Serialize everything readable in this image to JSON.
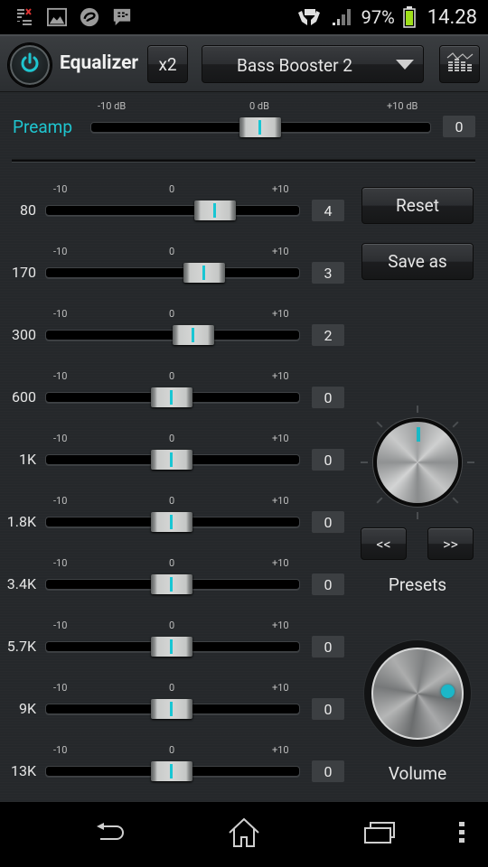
{
  "status_bar": {
    "notifications": [
      "task-list-icon",
      "image-icon",
      "chat-app-icon",
      "bbm-icon"
    ],
    "battery_percent": "97%",
    "battery_level": 0.97,
    "time": "14.28"
  },
  "header": {
    "power_on": true,
    "title": "Equalizer",
    "x2_label": "x2",
    "preset_selected": "Bass Booster 2"
  },
  "preamp": {
    "label": "Preamp",
    "min_label": "-10 dB",
    "mid_label": "0 dB",
    "max_label": "+10 dB",
    "value": 0,
    "value_text": "0",
    "min": -10,
    "max": 10
  },
  "band_scale": {
    "min_label": "-10",
    "mid_label": "0",
    "max_label": "+10",
    "min": -10,
    "max": 10
  },
  "bands": [
    {
      "label": "80",
      "value": 4,
      "value_text": "4"
    },
    {
      "label": "170",
      "value": 3,
      "value_text": "3"
    },
    {
      "label": "300",
      "value": 2,
      "value_text": "2"
    },
    {
      "label": "600",
      "value": 0,
      "value_text": "0"
    },
    {
      "label": "1K",
      "value": 0,
      "value_text": "0"
    },
    {
      "label": "1.8K",
      "value": 0,
      "value_text": "0"
    },
    {
      "label": "3.4K",
      "value": 0,
      "value_text": "0"
    },
    {
      "label": "5.7K",
      "value": 0,
      "value_text": "0"
    },
    {
      "label": "9K",
      "value": 0,
      "value_text": "0"
    },
    {
      "label": "13K",
      "value": 0,
      "value_text": "0"
    }
  ],
  "side": {
    "reset_label": "Reset",
    "save_as_label": "Save as",
    "prev_label": "<<",
    "next_label": ">>",
    "presets_label": "Presets",
    "volume_label": "Volume",
    "volume_level": 0.75
  },
  "colors": {
    "accent": "#1fc5cf",
    "background": "#25282b"
  }
}
